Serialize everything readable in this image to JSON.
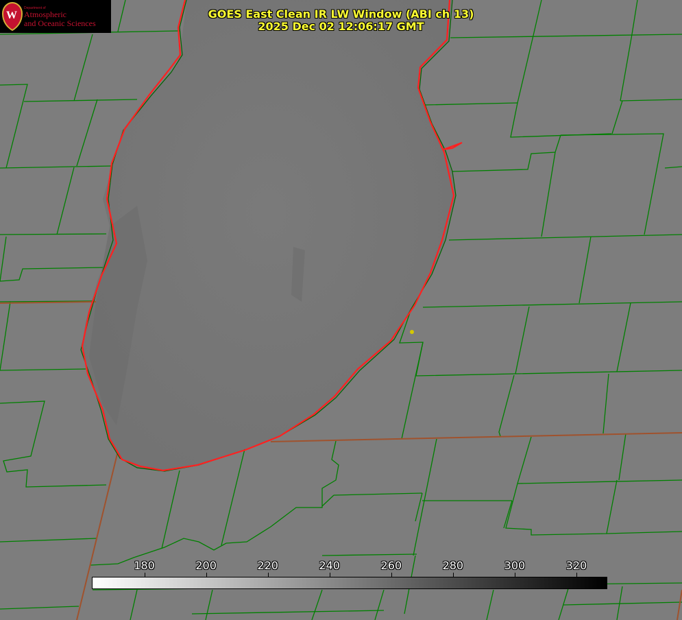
{
  "title": {
    "line1": "GOES East Clean IR LW Window (ABI ch 13)",
    "line2": "2025 Dec 02 12:06:17 GMT"
  },
  "logo": {
    "department": "Department of",
    "line1": "Atmospheric",
    "line2": "and Oceanic Sciences",
    "emblem": "W",
    "colors": {
      "background": "#000000",
      "text": "#c41230"
    }
  },
  "colorbar": {
    "min": 163,
    "max": 330,
    "tick_values": [
      180,
      200,
      220,
      240,
      260,
      280,
      300,
      320
    ],
    "tick_labels": [
      "180",
      "200",
      "220",
      "240",
      "260",
      "280",
      "300",
      "320"
    ],
    "gradient": {
      "from": "#ffffff",
      "to": "#000000"
    }
  },
  "map": {
    "colors": {
      "background": "#7d7d7d",
      "lake": "#777777",
      "county_lines": "#008000",
      "state_lines": "#a0522d",
      "coastline": "#ff2020",
      "marker": "#d4c800"
    },
    "icons": {
      "marker": "station-marker-icon"
    }
  }
}
